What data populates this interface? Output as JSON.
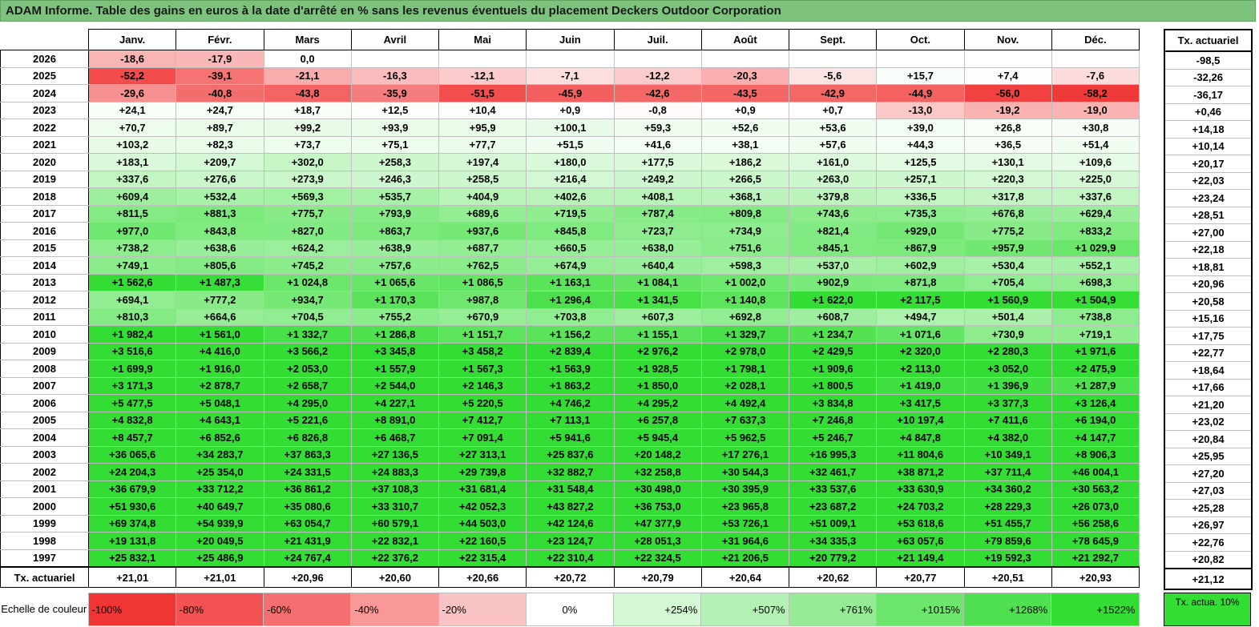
{
  "title": "ADAM Informe. Table des gains en euros à la date d'arrêté en % sans les revenus éventuels du placement Deckers Outdoor Corporation",
  "months": [
    "Janv.",
    "Févr.",
    "Mars",
    "Avril",
    "Mai",
    "Juin",
    "Juil.",
    "Août",
    "Sept.",
    "Oct.",
    "Nov.",
    "Déc."
  ],
  "actuarial_header": "Tx. actuariel",
  "rows": [
    {
      "year": "2026",
      "cells": [
        "-18,6",
        "-17,9",
        "0,0",
        "",
        "",
        "",
        "",
        "",
        "",
        "",
        "",
        ""
      ],
      "act": "-98,5"
    },
    {
      "year": "2025",
      "cells": [
        "-52,2",
        "-39,1",
        "-21,1",
        "-16,3",
        "-12,1",
        "-7,1",
        "-12,2",
        "-20,3",
        "-5,6",
        "+15,7",
        "+7,4",
        "-7,6"
      ],
      "act": "-32,26"
    },
    {
      "year": "2024",
      "cells": [
        "-29,6",
        "-40,8",
        "-43,8",
        "-35,9",
        "-51,5",
        "-45,9",
        "-42,6",
        "-43,5",
        "-42,9",
        "-44,9",
        "-56,0",
        "-58,2"
      ],
      "act": "-36,17"
    },
    {
      "year": "2023",
      "cells": [
        "+24,1",
        "+24,7",
        "+18,7",
        "+12,5",
        "+10,4",
        "+0,9",
        "-0,8",
        "+0,9",
        "+0,7",
        "-13,0",
        "-19,2",
        "-19,0"
      ],
      "act": "+0,46"
    },
    {
      "year": "2022",
      "cells": [
        "+70,7",
        "+89,7",
        "+99,2",
        "+93,9",
        "+95,9",
        "+100,1",
        "+59,3",
        "+52,6",
        "+53,6",
        "+39,0",
        "+26,8",
        "+30,8"
      ],
      "act": "+14,18"
    },
    {
      "year": "2021",
      "cells": [
        "+103,2",
        "+82,3",
        "+73,7",
        "+75,1",
        "+77,7",
        "+51,5",
        "+41,6",
        "+38,1",
        "+57,6",
        "+44,3",
        "+36,5",
        "+51,4"
      ],
      "act": "+10,14"
    },
    {
      "year": "2020",
      "cells": [
        "+183,1",
        "+209,7",
        "+302,0",
        "+258,3",
        "+197,4",
        "+180,0",
        "+177,5",
        "+186,2",
        "+161,0",
        "+125,5",
        "+130,1",
        "+109,6"
      ],
      "act": "+20,17"
    },
    {
      "year": "2019",
      "cells": [
        "+337,6",
        "+276,6",
        "+273,9",
        "+246,3",
        "+258,5",
        "+216,4",
        "+249,2",
        "+266,5",
        "+263,0",
        "+257,1",
        "+220,3",
        "+225,0"
      ],
      "act": "+22,03"
    },
    {
      "year": "2018",
      "cells": [
        "+609,4",
        "+532,4",
        "+569,3",
        "+535,7",
        "+404,9",
        "+402,6",
        "+408,1",
        "+368,1",
        "+379,8",
        "+336,5",
        "+317,8",
        "+337,6"
      ],
      "act": "+23,24"
    },
    {
      "year": "2017",
      "cells": [
        "+811,5",
        "+881,3",
        "+775,7",
        "+793,9",
        "+689,6",
        "+719,5",
        "+787,4",
        "+809,8",
        "+743,6",
        "+735,3",
        "+676,8",
        "+629,4"
      ],
      "act": "+28,51"
    },
    {
      "year": "2016",
      "cells": [
        "+977,0",
        "+843,8",
        "+827,0",
        "+863,7",
        "+937,6",
        "+845,8",
        "+723,7",
        "+734,9",
        "+821,4",
        "+929,0",
        "+775,2",
        "+833,2"
      ],
      "act": "+27,00"
    },
    {
      "year": "2015",
      "cells": [
        "+738,2",
        "+638,6",
        "+624,2",
        "+638,9",
        "+687,7",
        "+660,5",
        "+638,0",
        "+751,6",
        "+845,1",
        "+867,9",
        "+957,9",
        "+1 029,9"
      ],
      "act": "+22,18"
    },
    {
      "year": "2014",
      "cells": [
        "+749,1",
        "+805,6",
        "+745,2",
        "+757,6",
        "+762,5",
        "+674,9",
        "+640,4",
        "+598,3",
        "+537,0",
        "+602,9",
        "+530,4",
        "+552,1"
      ],
      "act": "+18,81"
    },
    {
      "year": "2013",
      "cells": [
        "+1 562,6",
        "+1 487,3",
        "+1 024,8",
        "+1 065,6",
        "+1 086,5",
        "+1 163,1",
        "+1 084,1",
        "+1 002,0",
        "+902,9",
        "+871,8",
        "+705,4",
        "+698,3"
      ],
      "act": "+20,96"
    },
    {
      "year": "2012",
      "cells": [
        "+694,1",
        "+777,2",
        "+934,7",
        "+1 170,3",
        "+987,8",
        "+1 296,4",
        "+1 341,5",
        "+1 140,8",
        "+1 622,0",
        "+2 117,5",
        "+1 560,9",
        "+1 504,9"
      ],
      "act": "+20,58"
    },
    {
      "year": "2011",
      "cells": [
        "+810,3",
        "+664,6",
        "+704,5",
        "+755,2",
        "+670,9",
        "+703,8",
        "+607,3",
        "+692,8",
        "+608,7",
        "+494,7",
        "+501,4",
        "+738,8"
      ],
      "act": "+15,16"
    },
    {
      "year": "2010",
      "cells": [
        "+1 982,4",
        "+1 561,0",
        "+1 332,7",
        "+1 286,8",
        "+1 151,7",
        "+1 156,2",
        "+1 155,1",
        "+1 329,7",
        "+1 234,7",
        "+1 071,6",
        "+730,9",
        "+719,1"
      ],
      "act": "+17,75"
    },
    {
      "year": "2009",
      "cells": [
        "+3 516,6",
        "+4 416,0",
        "+3 566,2",
        "+3 345,8",
        "+3 458,2",
        "+2 839,4",
        "+2 976,2",
        "+2 978,0",
        "+2 429,5",
        "+2 320,0",
        "+2 280,3",
        "+1 971,6"
      ],
      "act": "+22,77"
    },
    {
      "year": "2008",
      "cells": [
        "+1 699,9",
        "+1 916,0",
        "+2 053,0",
        "+1 557,9",
        "+1 567,3",
        "+1 563,9",
        "+1 928,5",
        "+1 798,1",
        "+1 909,6",
        "+2 113,0",
        "+3 052,0",
        "+2 475,9"
      ],
      "act": "+18,64"
    },
    {
      "year": "2007",
      "cells": [
        "+3 171,3",
        "+2 878,7",
        "+2 658,7",
        "+2 544,0",
        "+2 146,3",
        "+1 863,2",
        "+1 850,0",
        "+2 028,1",
        "+1 800,5",
        "+1 419,0",
        "+1 396,9",
        "+1 287,9"
      ],
      "act": "+17,66"
    },
    {
      "year": "2006",
      "cells": [
        "+5 477,5",
        "+5 048,1",
        "+4 295,0",
        "+4 227,1",
        "+5 220,5",
        "+4 746,2",
        "+4 295,2",
        "+4 492,4",
        "+3 834,8",
        "+3 417,5",
        "+3 377,3",
        "+3 126,4"
      ],
      "act": "+21,20"
    },
    {
      "year": "2005",
      "cells": [
        "+4 832,8",
        "+4 643,1",
        "+5 221,6",
        "+8 891,0",
        "+7 412,7",
        "+7 113,1",
        "+6 257,8",
        "+7 637,3",
        "+7 246,8",
        "+10 197,4",
        "+7 411,6",
        "+6 194,0"
      ],
      "act": "+23,02"
    },
    {
      "year": "2004",
      "cells": [
        "+8 457,7",
        "+6 852,6",
        "+6 826,8",
        "+6 468,7",
        "+7 091,4",
        "+5 941,6",
        "+5 945,4",
        "+5 962,5",
        "+5 246,7",
        "+4 847,8",
        "+4 382,0",
        "+4 147,7"
      ],
      "act": "+20,84"
    },
    {
      "year": "2003",
      "cells": [
        "+36 065,6",
        "+34 283,7",
        "+37 863,3",
        "+27 136,5",
        "+27 313,1",
        "+25 837,6",
        "+20 148,2",
        "+17 276,1",
        "+16 995,3",
        "+11 804,6",
        "+10 349,1",
        "+8 906,3"
      ],
      "act": "+25,95"
    },
    {
      "year": "2002",
      "cells": [
        "+24 204,3",
        "+25 354,0",
        "+24 331,5",
        "+24 883,3",
        "+29 739,8",
        "+32 882,7",
        "+32 258,8",
        "+30 544,3",
        "+32 461,7",
        "+38 871,2",
        "+37 711,4",
        "+46 004,1"
      ],
      "act": "+27,20"
    },
    {
      "year": "2001",
      "cells": [
        "+36 679,9",
        "+33 712,2",
        "+36 861,2",
        "+37 108,3",
        "+31 681,4",
        "+31 548,4",
        "+30 498,0",
        "+30 395,9",
        "+33 537,6",
        "+33 630,9",
        "+34 360,2",
        "+30 563,2"
      ],
      "act": "+27,03"
    },
    {
      "year": "2000",
      "cells": [
        "+51 930,6",
        "+40 649,7",
        "+35 080,6",
        "+33 310,7",
        "+42 052,3",
        "+43 827,2",
        "+36 753,0",
        "+23 965,8",
        "+23 687,2",
        "+24 703,2",
        "+28 229,3",
        "+26 073,0"
      ],
      "act": "+25,28"
    },
    {
      "year": "1999",
      "cells": [
        "+69 374,8",
        "+54 939,9",
        "+63 054,7",
        "+60 579,1",
        "+44 503,0",
        "+42 124,6",
        "+47 377,9",
        "+53 726,1",
        "+51 009,1",
        "+53 618,6",
        "+51 455,7",
        "+56 258,6"
      ],
      "act": "+26,97"
    },
    {
      "year": "1998",
      "cells": [
        "+19 131,8",
        "+20 049,5",
        "+21 431,9",
        "+22 832,1",
        "+22 160,5",
        "+23 124,7",
        "+28 051,3",
        "+31 964,6",
        "+34 335,3",
        "+63 057,6",
        "+79 859,6",
        "+78 645,9"
      ],
      "act": "+22,76"
    },
    {
      "year": "1997",
      "cells": [
        "+25 832,1",
        "+25 486,9",
        "+24 767,4",
        "+22 376,2",
        "+22 315,4",
        "+22 310,4",
        "+22 324,5",
        "+21 206,5",
        "+20 779,2",
        "+21 149,4",
        "+19 592,3",
        "+21 292,7"
      ],
      "act": "+20,82"
    }
  ],
  "tx_row": {
    "label": "Tx. actuariel",
    "cells": [
      "+21,01",
      "+21,01",
      "+20,96",
      "+20,60",
      "+20,66",
      "+20,72",
      "+20,79",
      "+20,64",
      "+20,62",
      "+20,77",
      "+20,51",
      "+20,93"
    ],
    "act": "+21,12"
  },
  "legend": {
    "label": "Echelle de couleur",
    "items": [
      {
        "text": "-100%",
        "color": "#f03535",
        "align": "left"
      },
      {
        "text": "-80%",
        "color": "#f25252",
        "align": "left"
      },
      {
        "text": "-60%",
        "color": "#f46f6f",
        "align": "left"
      },
      {
        "text": "-40%",
        "color": "#f89898",
        "align": "left"
      },
      {
        "text": "-20%",
        "color": "#fbc4c4",
        "align": "left"
      },
      {
        "text": "0%",
        "color": "#ffffff",
        "align": "center"
      },
      {
        "text": "+254%",
        "color": "#d4f8d4",
        "align": "right"
      },
      {
        "text": "+507%",
        "color": "#b4f1b4",
        "align": "right"
      },
      {
        "text": "+761%",
        "color": "#96ec96",
        "align": "right"
      },
      {
        "text": "+1015%",
        "color": "#6de66d",
        "align": "right"
      },
      {
        "text": "+1268%",
        "color": "#4ee04e",
        "align": "right"
      },
      {
        "text": "+1522%",
        "color": "#33dd33",
        "align": "right"
      }
    ],
    "actuarial_text": "Tx. actua. 10%",
    "actuarial_color": "#33dd33"
  },
  "colors": {
    "title_bg": "#7dc27d",
    "neg_max": "#f03535",
    "neutral": "#ffffff",
    "pos_max": "#33dd33"
  }
}
